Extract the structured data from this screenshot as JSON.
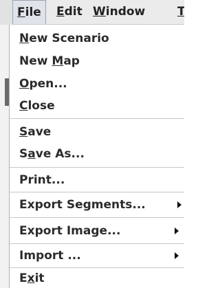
{
  "menubar": {
    "items": [
      {
        "label": "File",
        "mnemonic": "F",
        "rest": "ile"
      },
      {
        "label": "Edit",
        "mnemonic": "E",
        "rest": "dit"
      },
      {
        "label": "Window",
        "mnemonic": "W",
        "rest": "indow"
      },
      {
        "label": "T",
        "mnemonic": "T",
        "rest": ""
      }
    ]
  },
  "file_menu": {
    "items": [
      {
        "pre": "",
        "mn": "N",
        "post": "ew Scenario"
      },
      {
        "pre": "New ",
        "mn": "M",
        "post": "ap"
      },
      {
        "pre": "",
        "mn": "O",
        "post": "pen..."
      },
      {
        "pre": "",
        "mn": "C",
        "post": "lose"
      },
      {
        "pre": "",
        "mn": "S",
        "post": "ave"
      },
      {
        "pre": "S",
        "mn": "a",
        "post": "ve As..."
      },
      {
        "pre": "Print...",
        "mn": "",
        "post": ""
      },
      {
        "pre": "Export Segments...",
        "mn": "",
        "post": ""
      },
      {
        "pre": "Export Image...",
        "mn": "",
        "post": ""
      },
      {
        "pre": "Import ...",
        "mn": "",
        "post": ""
      },
      {
        "pre": "E",
        "mn": "x",
        "post": "it"
      }
    ]
  }
}
